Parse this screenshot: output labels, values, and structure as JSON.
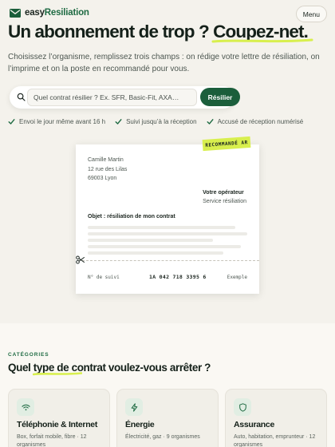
{
  "header": {
    "brand_prefix": "easy",
    "brand_suffix": "Resiliation",
    "menu_label": "Menu"
  },
  "hero": {
    "headline_start": "Un abonnement de trop ? ",
    "headline_highlight": "Coupez-net.",
    "intro": "Choisissez l’organisme, remplissez trois champs : on rédige votre lettre de résiliation, on l’imprime et on la poste en recommandé pour vous.",
    "search": {
      "placeholder": "Quel contrat résilier ? Ex. SFR, Basic-Fit, AXA…",
      "value": "",
      "button_label": "Résilier"
    },
    "features": [
      {
        "label": "Envoi le jour même avant 16 h"
      },
      {
        "label": "Suivi jusqu’à la réception"
      },
      {
        "label": "Accusé de réception numérisé"
      }
    ]
  },
  "letter": {
    "stamp": "RECOMMANDÉ AR",
    "sender_name": "Camille Martin",
    "sender_street": "12 rue des Lilas",
    "sender_city": "69003 Lyon",
    "recipient_name": "Votre opérateur",
    "recipient_dept": "Service résiliation",
    "subject": "Objet : résiliation de mon contrat",
    "tracking_label": "N° de suivi",
    "tracking_number": "1A 042 718 3395 6",
    "tracking_tag": "Exemple"
  },
  "categories": {
    "kicker": "CATÉGORIES",
    "title_start": "Quel ",
    "title_highlight": "type de",
    "title_end": " contrat voulez-vous arrêter ?",
    "cards": [
      {
        "icon": "wifi-icon",
        "title": "Téléphonie & Internet",
        "desc": "Box, forfait mobile, fibre · 12 organismes"
      },
      {
        "icon": "lightning-icon",
        "title": "Énergie",
        "desc": "Électricité, gaz · 9 organismes"
      },
      {
        "icon": "shield-icon",
        "title": "Assurance",
        "desc": "Auto, habitation, emprunteur · 12 organismes"
      }
    ]
  },
  "colors": {
    "brand_green": "#1b5e3b",
    "lime_accent": "#d8ef4e",
    "background": "#f4f2ec"
  }
}
